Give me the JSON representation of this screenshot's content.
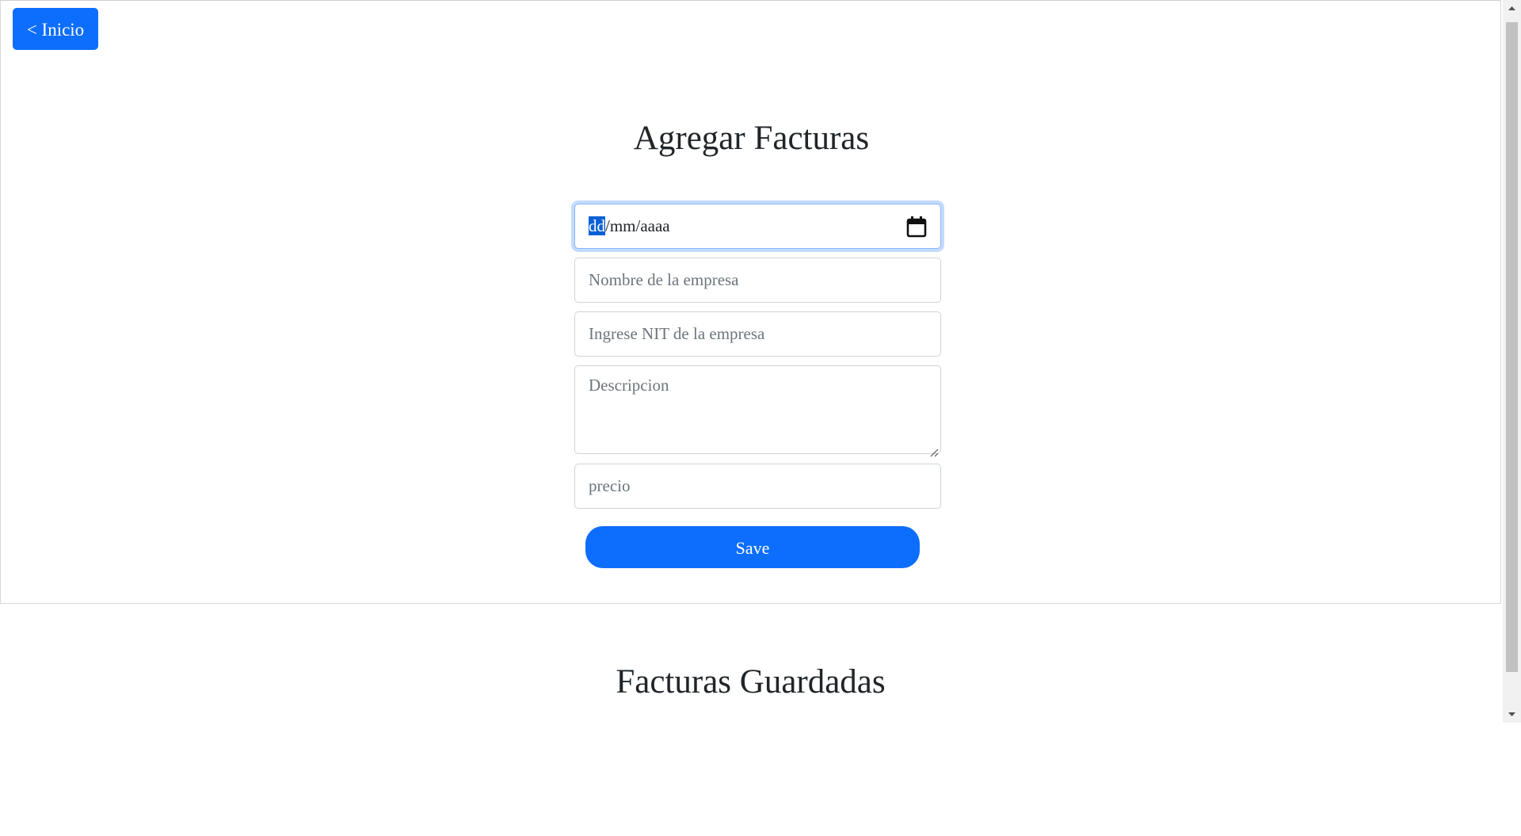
{
  "nav": {
    "back_label": "< Inicio"
  },
  "form": {
    "title": "Agregar Facturas",
    "date": {
      "day_placeholder": "dd",
      "rest_placeholder": "/mm/aaaa"
    },
    "company_placeholder": "Nombre de la empresa",
    "nit_placeholder": "Ingrese NIT de la empresa",
    "description_placeholder": "Descripcion",
    "price_placeholder": "precio",
    "save_label": "Save"
  },
  "saved": {
    "title": "Facturas Guardadas"
  },
  "colors": {
    "primary": "#0d6efd",
    "focus_ring": "#86b7fe"
  },
  "icons": {
    "date": "calendar-icon",
    "scroll_up": "arrow-up-icon",
    "scroll_down": "arrow-down-icon"
  }
}
